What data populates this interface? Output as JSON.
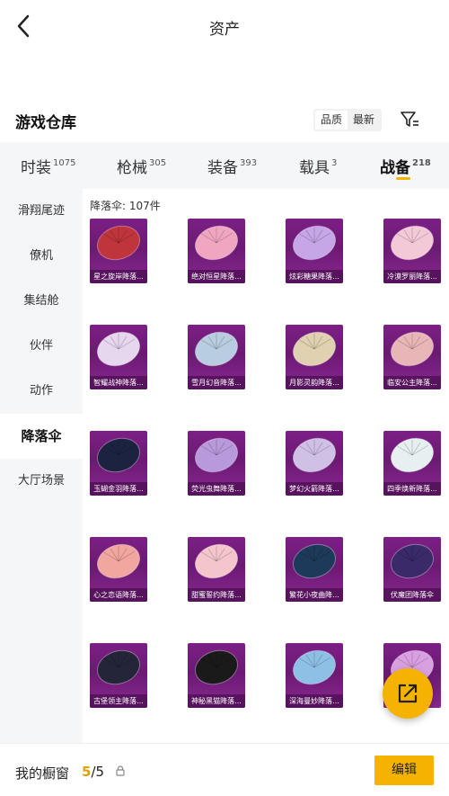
{
  "header": {
    "title": "资产"
  },
  "warehouse": {
    "title": "游戏仓库",
    "sort_options": [
      "品质",
      "最新"
    ]
  },
  "tabs": [
    {
      "label": "时装",
      "count": "1075"
    },
    {
      "label": "枪械",
      "count": "305"
    },
    {
      "label": "装备",
      "count": "393"
    },
    {
      "label": "载具",
      "count": "3"
    },
    {
      "label": "战备",
      "count": "218"
    }
  ],
  "sidebar": {
    "items": [
      "滑翔尾迹",
      "僚机",
      "集结舱",
      "伙伴",
      "动作",
      "降落伞",
      "大厅场景"
    ]
  },
  "content": {
    "count_label": "降落伞: 107件",
    "items": [
      {
        "name": "星之旋岸降落...",
        "color": "#c0343c"
      },
      {
        "name": "绝对恒星降落...",
        "color": "#f0a6c0"
      },
      {
        "name": "炫彩糖果降落...",
        "color": "#c6a6e6"
      },
      {
        "name": "冷漠罗丽降落...",
        "color": "#f3c9d8"
      },
      {
        "name": "智耀战神降落...",
        "color": "#e6d6ee"
      },
      {
        "name": "雪月幻音降落...",
        "color": "#b8cde0"
      },
      {
        "name": "月影灵韵降落...",
        "color": "#e0d2b0"
      },
      {
        "name": "临安公主降落...",
        "color": "#e9b6b8"
      },
      {
        "name": "玉蝴金羽降落...",
        "color": "#1c2340"
      },
      {
        "name": "荧光虫舞降落...",
        "color": "#b89adc"
      },
      {
        "name": "梦幻火箭降落...",
        "color": "#cfc0e6"
      },
      {
        "name": "四季焕新降落...",
        "color": "#e6f0f0"
      },
      {
        "name": "心之恋语降落...",
        "color": "#f2a6a0"
      },
      {
        "name": "甜蜜誓约降落...",
        "color": "#f4c6cc"
      },
      {
        "name": "繁花小夜曲降...",
        "color": "#1d3a5a"
      },
      {
        "name": "伏魔团降落伞",
        "color": "#3a2a6a"
      },
      {
        "name": "古堡领主降落...",
        "color": "#25253a"
      },
      {
        "name": "神秘黑猫降落...",
        "color": "#1a1a1a"
      },
      {
        "name": "深海曼妙降落...",
        "color": "#8ec0e6"
      },
      {
        "name": "",
        "color": "#d8a0e0"
      }
    ]
  },
  "bottom": {
    "showcase_label": "我的橱窗",
    "showcase_current": "5",
    "showcase_total": "/5",
    "edit_label": "编辑"
  },
  "colors": {
    "accent": "#f5b300",
    "card_bg": "#7d1f86"
  },
  "icons": {
    "back": "back-arrow-icon",
    "filter": "filter-icon",
    "share": "share-icon",
    "lock": "lock-icon"
  }
}
